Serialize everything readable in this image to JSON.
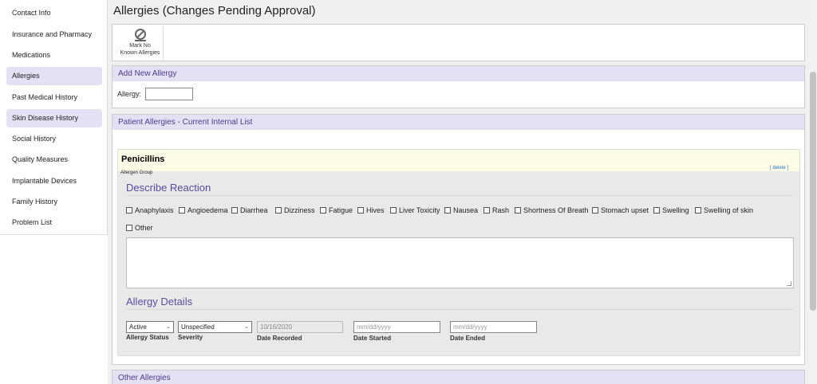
{
  "sidebar": {
    "items": [
      {
        "label": "Contact Info"
      },
      {
        "label": "Insurance and Pharmacy"
      },
      {
        "label": "Medications"
      },
      {
        "label": "Allergies"
      },
      {
        "label": "Past Medical History"
      },
      {
        "label": "Skin Disease History"
      },
      {
        "label": "Social History"
      },
      {
        "label": "Quality Measures"
      },
      {
        "label": "Implantable Devices"
      },
      {
        "label": "Family History"
      },
      {
        "label": "Problem List"
      }
    ]
  },
  "page": {
    "title": "Allergies (Changes Pending Approval)"
  },
  "toolbar": {
    "nka_line1": "Mark No",
    "nka_line2": "Known Allergies",
    "nka_icon": "no-symbol-icon"
  },
  "add_allergy": {
    "heading": "Add New Allergy",
    "label": "Allergy:",
    "value": ""
  },
  "patient_allergies": {
    "heading": "Patient Allergies - Current Internal List"
  },
  "allergen": {
    "name": "Penicillins",
    "type": "Allergen Group",
    "delete_label": "[ delete ]",
    "reaction_title": "Describe Reaction",
    "reactions": [
      "Anaphylaxis",
      "Angioedema",
      "Diarrhea",
      "Dizziness",
      "Fatigue",
      "Hives",
      "Liver Toxicity",
      "Nausea",
      "Rash",
      "Shortness Of Breath",
      "Stomach upset",
      "Swelling",
      "Swelling of skin",
      "Other"
    ],
    "details_title": "Allergy Details",
    "status": {
      "value": "Active",
      "label": "Allergy Status"
    },
    "severity": {
      "value": "Unspecified",
      "label": "Severity"
    },
    "date_recorded": {
      "value": "10/16/2020",
      "label": "Date Recorded"
    },
    "date_started": {
      "placeholder": "mm/dd/yyyy",
      "label": "Date Started"
    },
    "date_ended": {
      "placeholder": "mm/dd/yyyy",
      "label": "Date Ended"
    }
  },
  "other_allergies": {
    "heading": "Other Allergies"
  },
  "colors": {
    "accent": "#5b4aa0",
    "panel_header": "#e5e1f5",
    "active_nav": "#e5e1f5",
    "allergen_highlight": "#fcfbe6"
  }
}
